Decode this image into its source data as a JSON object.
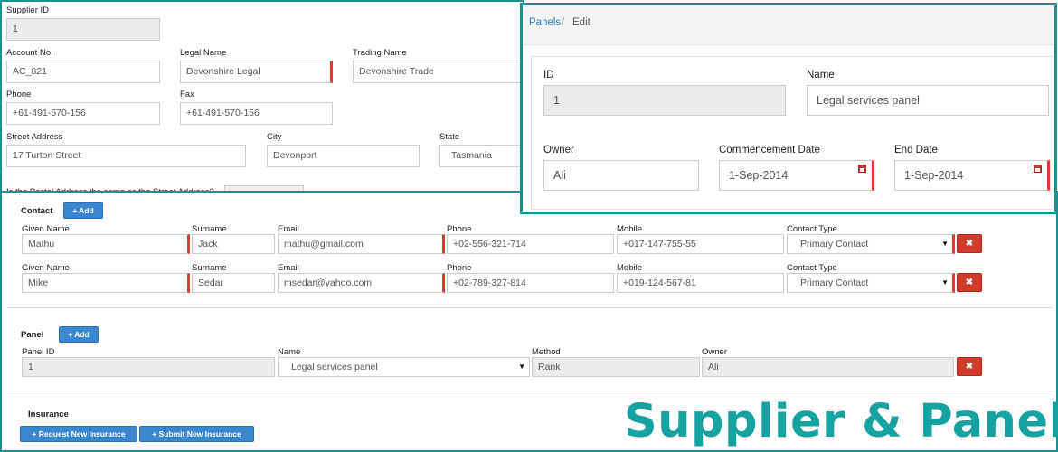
{
  "supplier": {
    "supplier_id_label": "Supplier ID",
    "supplier_id_value": "1",
    "account_no_label": "Account No.",
    "account_no_value": "AC_821",
    "legal_name_label": "Legal Name",
    "legal_name_value": "Devonshire Legal",
    "trading_name_label": "Trading Name",
    "trading_name_value": "Devonshire Trade",
    "phone_label": "Phone",
    "phone_value": "+61-491-570-156",
    "fax_label": "Fax",
    "fax_value": "+61-491-570-156",
    "street_label": "Street Address",
    "street_value": "17 Turton Street",
    "city_label": "City",
    "city_value": "Devonport",
    "state_label": "State",
    "state_value": "Tasmania",
    "postal_question": "Is the Postal Address the same as the Street Address?"
  },
  "panel_edit": {
    "breadcrumb_link": "Panels",
    "breadcrumb_sep": "/",
    "breadcrumb_current": "Edit",
    "id_label": "ID",
    "id_value": "1",
    "name_label": "Name",
    "name_value": "Legal services panel",
    "owner_label": "Owner",
    "owner_value": "Ali",
    "commencement_label": "Commencement Date",
    "commencement_value": "1-Sep-2014",
    "end_label": "End Date",
    "end_value": "1-Sep-2014"
  },
  "contact": {
    "title": "Contact",
    "add_label": "+ Add",
    "headers": {
      "given": "Given Name",
      "surname": "Surname",
      "email": "Email",
      "phone": "Phone",
      "mobile": "Mobile",
      "type": "Contact Type"
    },
    "rows": [
      {
        "given": "Mathu",
        "surname": "Jack",
        "email": "mathu@gmail.com",
        "phone": "+02-556-321-714",
        "mobile": "+017-147-755-55",
        "type": "Primary Contact"
      },
      {
        "given": "Mike",
        "surname": "Sedar",
        "email": "msedar@yahoo.com",
        "phone": "+02-789-327-814",
        "mobile": "+019-124-567-81",
        "type": "Primary Contact"
      }
    ]
  },
  "panel": {
    "title": "Panel",
    "add_label": "+ Add",
    "headers": {
      "id": "Panel ID",
      "name": "Name",
      "method": "Method",
      "owner": "Owner"
    },
    "row": {
      "id": "1",
      "name": "Legal services panel",
      "method": "Rank",
      "owner": "Ali"
    }
  },
  "insurance": {
    "title": "Insurance",
    "request_label": "+ Request New Insurance",
    "submit_label": "+ Submit New Insurance"
  },
  "icons": {
    "remove": "✖",
    "dropdown": "▼"
  },
  "watermark": "Supplier & Panel",
  "colors": {
    "accent": "#1f8f8f",
    "primary": "#3a87d0",
    "danger": "#d23a2a",
    "required": "#e03a2e"
  }
}
